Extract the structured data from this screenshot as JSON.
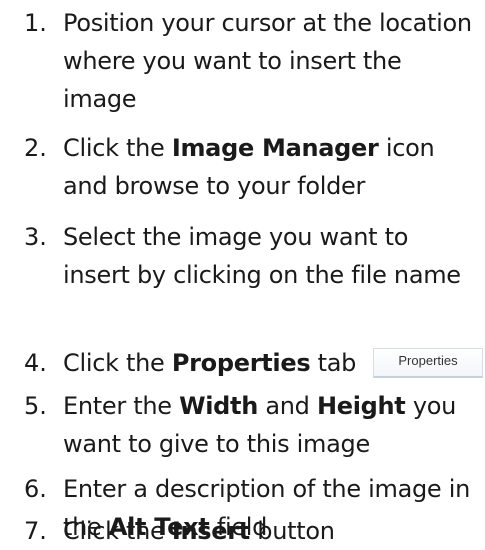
{
  "steps": [
    {
      "number": "1.",
      "text": "Position your cursor at the location where you want to insert the image"
    },
    {
      "number": "2.",
      "pre": "Click the ",
      "bold": "Image Manager",
      "post": " icon and browse to your folder"
    },
    {
      "number": "3.",
      "text": "Select the image you want to insert by clicking on the file name"
    },
    {
      "number": "4.",
      "pre": "Click the ",
      "bold": "Properties",
      "post": " tab",
      "button_label": "Properties"
    },
    {
      "number": "5.",
      "pre": "Enter the ",
      "bold": "Width",
      "mid": " and ",
      "bold2": "Height",
      "post": " you want to give to this image"
    },
    {
      "number": "6.",
      "pre": "Enter a description of the image in the ",
      "bold": "Alt Text",
      "post": " field"
    },
    {
      "number": "7.",
      "pre": "Click the ",
      "bold": "Insert",
      "post": " button"
    }
  ]
}
